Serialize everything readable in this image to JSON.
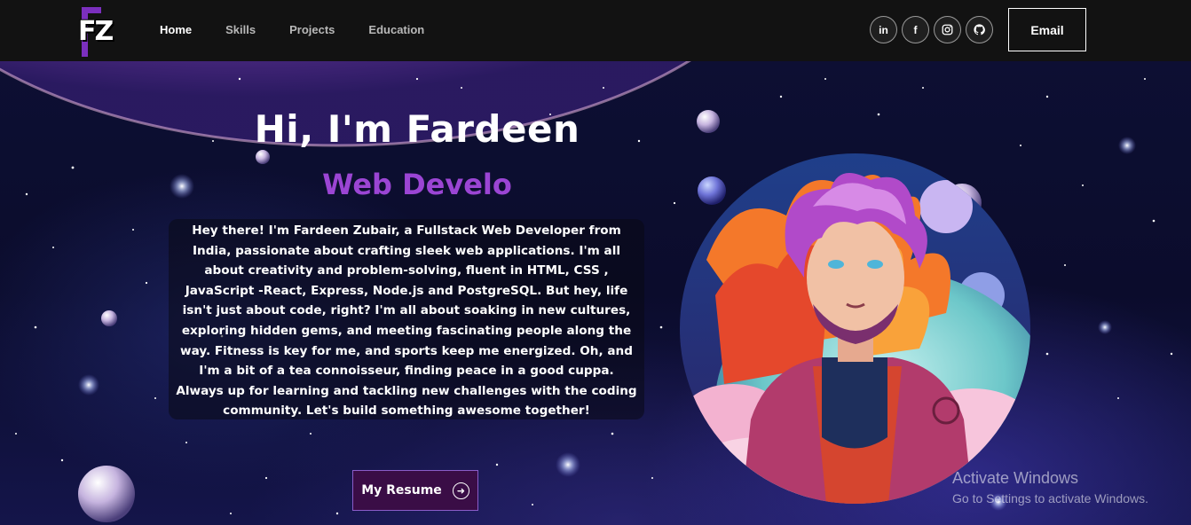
{
  "nav": {
    "logo_text": "FZ",
    "links": [
      {
        "label": "Home",
        "active": true
      },
      {
        "label": "Skills",
        "active": false
      },
      {
        "label": "Projects",
        "active": false
      },
      {
        "label": "Education",
        "active": false
      }
    ],
    "socials": [
      {
        "name": "linkedin-icon",
        "glyph": "in"
      },
      {
        "name": "facebook-icon",
        "glyph": "f"
      },
      {
        "name": "instagram-icon",
        "glyph": ""
      },
      {
        "name": "github-icon",
        "glyph": ""
      }
    ],
    "email_label": "Email"
  },
  "hero": {
    "greeting": "Hi, I'm Fardeen",
    "role": "Web Develo",
    "bio": "Hey there! I'm Fardeen Zubair, a Fullstack Web Developer from India, passionate about crafting sleek web applications. I'm all about creativity and problem-solving, fluent in HTML, CSS , JavaScript -React, Express, Node.js and PostgreSQL. But hey, life isn't just about code, right? I'm all about soaking in new cultures, exploring hidden gems, and meeting fascinating people along the way. Fitness is key for me, and sports keep me energized. Oh, and I'm a bit of a tea connoisseur, finding peace in a good cuppa. Always up for learning and tackling new challenges with the coding community. Let's build something awesome together!",
    "resume_label": "My Resume"
  },
  "watermark": {
    "title": "Activate Windows",
    "subtitle": "Go to Settings to activate Windows."
  },
  "colors": {
    "accent": "#9b45d4",
    "navbar_bg": "#121212",
    "resume_bg": "#3a0d46"
  }
}
